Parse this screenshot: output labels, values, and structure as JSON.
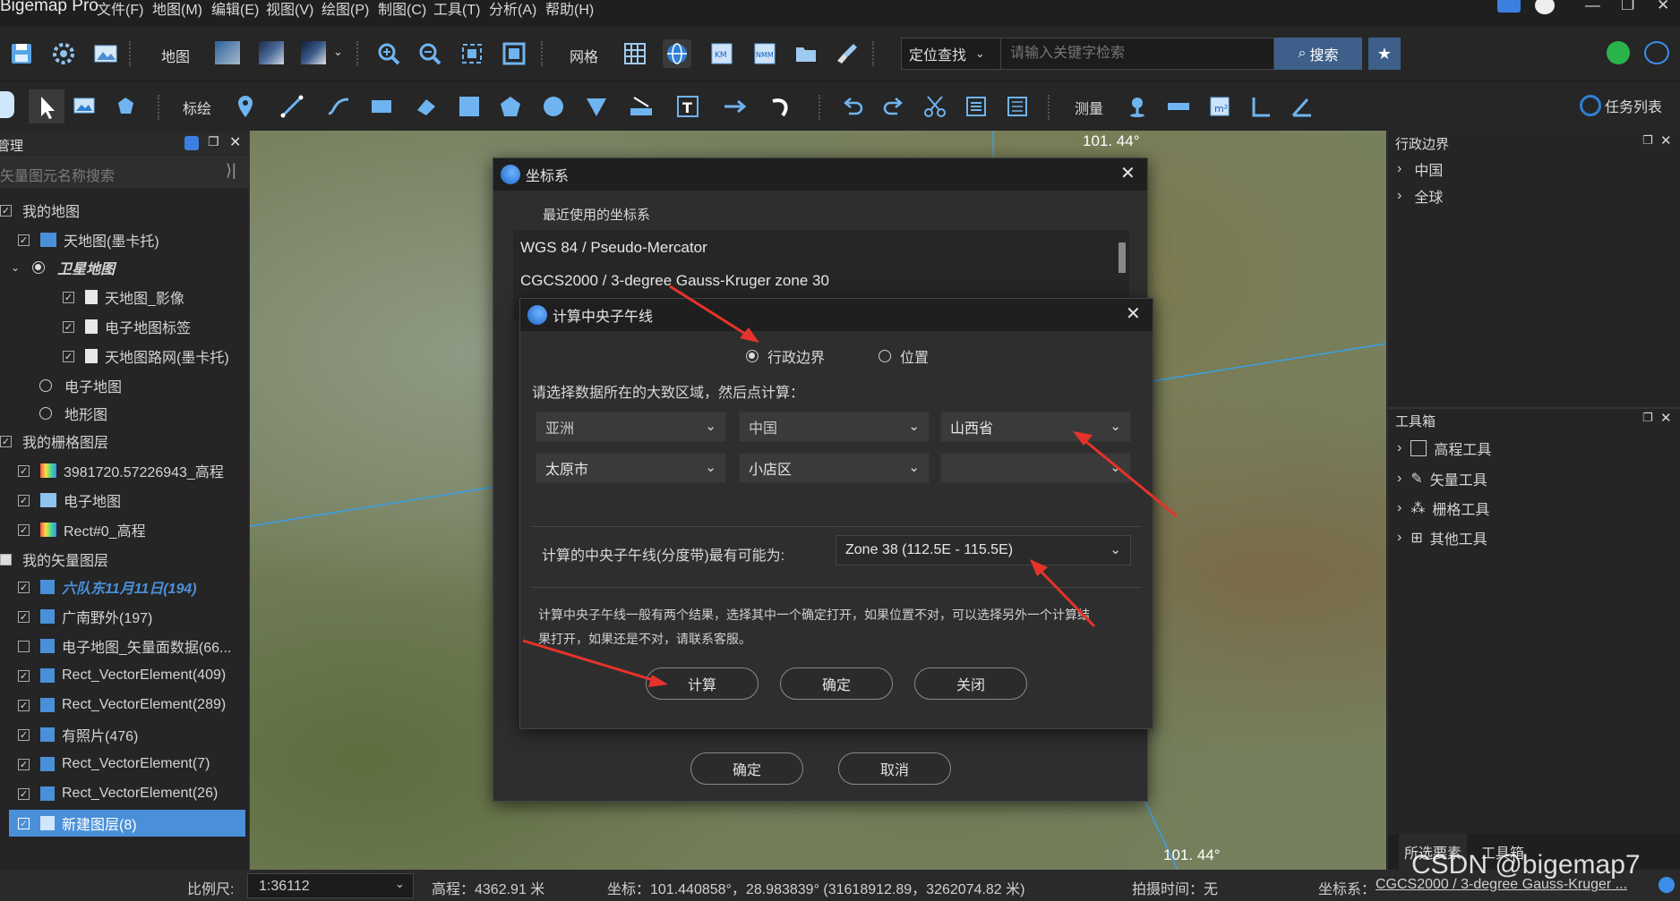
{
  "app": {
    "title": "Bigemap Pro",
    "menu": [
      "文件(F)",
      "地图(M)",
      "编辑(E)",
      "视图(V)",
      "绘图(P)",
      "制图(C)",
      "工具(T)",
      "分析(A)",
      "帮助(H)"
    ]
  },
  "toolbar1": {
    "map_label": "地图",
    "grid_label": "网格",
    "locate_label": "定位查找",
    "search_placeholder": "请输入关键字检索",
    "search_button": "搜索"
  },
  "toolbar2": {
    "annotate_label": "标绘",
    "measure_label": "测量",
    "task_list": "任务列表"
  },
  "left_panel": {
    "header": "管理",
    "search_placeholder": "矢量图元名称搜索",
    "my_maps": "我的地图",
    "tianditu_mercator": "天地图(墨卡托)",
    "satellite_map": "卫星地图",
    "tianditu_image": "天地图_影像",
    "e_map_label": "电子地图标签",
    "tianditu_road": "天地图路网(墨卡托)",
    "e_map": "电子地图",
    "terrain_map": "地形图",
    "my_raster_layers": "我的栅格图层",
    "raster_items": [
      "3981720.57226943_高程",
      "电子地图",
      "Rect#0_高程"
    ],
    "my_vector_layers": "我的矢量图层",
    "vector_items": [
      "六队东11月11日(194)",
      "广南野外(197)",
      "电子地图_矢量面数据(66...",
      "Rect_VectorElement(409)",
      "Rect_VectorElement(289)",
      "有照片(476)",
      "Rect_VectorElement(7)",
      "Rect_VectorElement(26)",
      "新建图层(8)"
    ]
  },
  "map": {
    "lon_top": "101. 44°",
    "lon_bottom": "101. 44°"
  },
  "right_panel": {
    "admin_header": "行政边界",
    "admin_items": [
      "中国",
      "全球"
    ],
    "toolbox_header": "工具箱",
    "tools": [
      "高程工具",
      "矢量工具",
      "栅格工具",
      "其他工具"
    ],
    "tab_selected": "所选要素",
    "tab_toolbox": "工具箱"
  },
  "coord_dialog": {
    "title": "坐标系",
    "recent_label": "最近使用的坐标系",
    "items": [
      "WGS 84 / Pseudo-Mercator",
      "CGCS2000 / 3-degree Gauss-Kruger zone 30"
    ],
    "ok": "确定",
    "cancel": "取消"
  },
  "meridian_dialog": {
    "title": "计算中央子午线",
    "radio_admin": "行政边界",
    "radio_position": "位置",
    "instruction": "请选择数据所在的大致区域，然后点计算：",
    "continent": "亚洲",
    "country": "中国",
    "province": "山西省",
    "city": "太原市",
    "district": "小店区",
    "result_label": "计算的中央子午线(分度带)最有可能为:",
    "result_value": "Zone 38 (112.5E - 115.5E)",
    "note_line1": "计算中央子午线一般有两个结果，选择其中一个确定打开，如果位置不对，可以选择另外一个计算结",
    "note_line2": "果打开，如果还是不对，请联系客服。",
    "calc": "计算",
    "ok": "确定",
    "close": "关闭"
  },
  "statusbar": {
    "scale_label": "比例尺:",
    "scale_value": "1:36112",
    "elevation": "高程：4362.91 米",
    "coords": "坐标：101.440858°，28.983839°  (31618912.89，3262074.82 米)",
    "capture_time": "拍摄时间：无",
    "crs_label": "坐标系：",
    "crs_value": "CGCS2000 / 3-degree Gauss-Kruger ..."
  },
  "watermark": "CSDN @bigemap7",
  "colors": {
    "accent": "#1e6fd9",
    "selected_row": "#4a90d9",
    "arrow": "#e6332a"
  }
}
